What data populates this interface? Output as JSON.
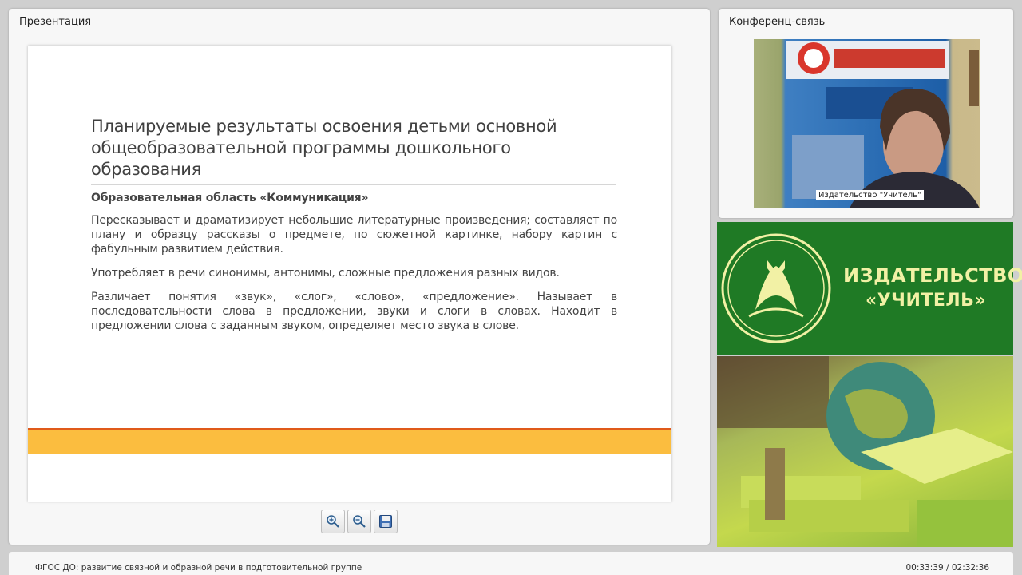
{
  "presentation_panel": {
    "title": "Презентация"
  },
  "slide": {
    "title": "Планируемые результаты освоения детьми основной общеобразовательной программы дошкольного образования",
    "section": "Образовательная область «Коммуникация»",
    "paragraphs": [
      "Пересказывает и драматизирует небольшие литературные произведения; составляет по плану и образцу рассказы о предмете, по сюжетной картинке, набору картин с фабульным развитием действия.",
      "Употребляет в речи синонимы, антонимы, сложные предложения разных видов.",
      "Различает понятия «звук», «слог», «слово», «предложение». Называет в последовательности слова в предложении, звуки и слоги в словах. Находит в предложении слова с заданным звуком, определяет место звука в слове."
    ]
  },
  "toolbar": {
    "zoom_in_icon": "zoom-in-icon",
    "zoom_out_icon": "zoom-out-icon",
    "save_icon": "save-icon"
  },
  "conference_panel": {
    "title": "Конференц-связь",
    "video_caption": "Издательство \"Учитель\""
  },
  "logo_banner": {
    "line1": "ИЗДАТЕЛЬСТВО",
    "line2": "«УЧИТЕЛЬ»"
  },
  "footer": {
    "title": "ФГОС ДО: развитие связной и образной речи в подготовительной группе",
    "time": "00:33:39 / 02:32:36"
  },
  "colors": {
    "slide_red_line": "#e05a1a",
    "slide_orange_band": "#fbbd3f",
    "logo_green": "#1f7a25",
    "logo_text": "#f2f1a5"
  }
}
